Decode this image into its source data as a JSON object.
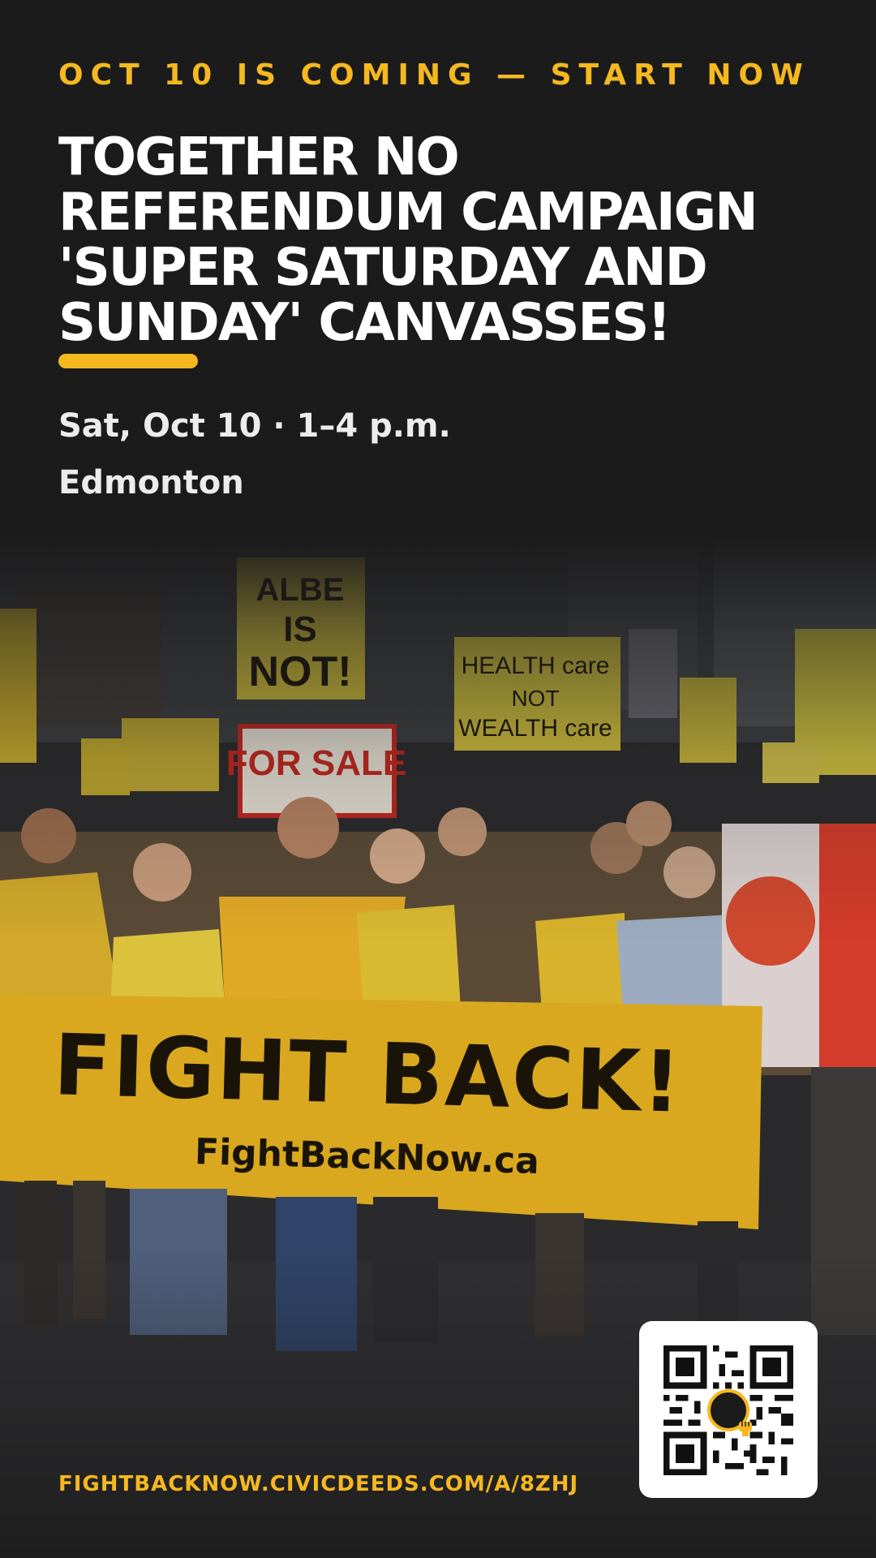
{
  "header": {
    "eyebrow": "OCT 10 IS COMING — START NOW",
    "title": "TOGETHER NO REFERENDUM CAMPAIGN 'SUPER SATURDAY AND SUNDAY' CANVASSES!"
  },
  "event": {
    "date_time": "Sat, Oct 10 · 1–4 p.m.",
    "location": "Edmonton"
  },
  "photo": {
    "description_icon": "protest-crowd-photo",
    "banner_text": "FIGHT BACK!",
    "banner_url": "FightBackNow.ca"
  },
  "footer": {
    "url": "FIGHTBACKNOW.CIVICDEEDS.COM/A/8ZHJ",
    "qr_icon": "qr-code-icon",
    "qr_logo_icon": "raised-fist-icon"
  },
  "colors": {
    "background": "#1b1b1c",
    "accent": "#f5b81f",
    "text": "#ffffff"
  }
}
